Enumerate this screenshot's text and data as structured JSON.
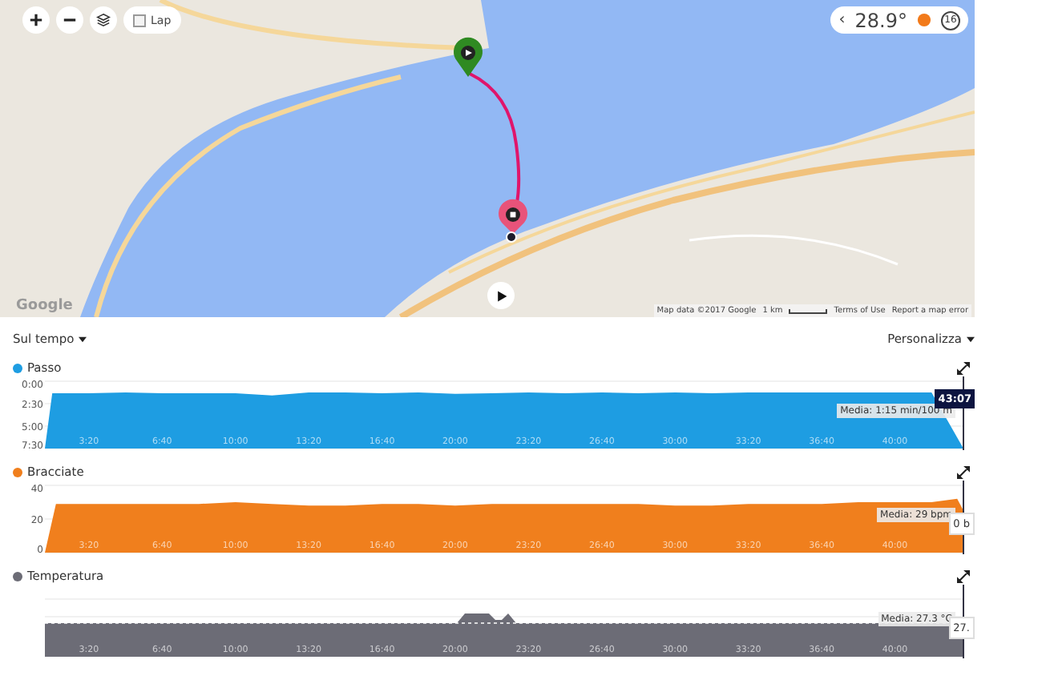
{
  "map": {
    "logo": "Google",
    "lap": {
      "label": "Lap",
      "checked": false
    },
    "weather": {
      "back": "‹",
      "temperature": "28.9°",
      "wind": "16"
    },
    "attribution": [
      "Map data ©2017 Google",
      "1 km",
      "Terms of Use",
      "Report a map error"
    ]
  },
  "toolbar": {
    "view": "Sul tempo",
    "customize": "Personalizza"
  },
  "charts": [
    {
      "color": "#1e9de2",
      "average": "Media: 1:15 min/100 m",
      "readout": {
        "text": "43:07",
        "kind": "time"
      },
      "chart_data": {
        "type": "area",
        "x": [
          80,
          100,
          200,
          300,
          400,
          500,
          600,
          700,
          800,
          900,
          1000,
          1100,
          1200,
          1300,
          1400,
          1500,
          1600,
          1700,
          1800,
          1900,
          2000,
          2100,
          2200,
          2300,
          2400,
          2500,
          2587
        ],
        "series": [
          {
            "name": "Passo",
            "color": "#1e9de2",
            "values": [
              450,
              80,
              80,
              75,
              80,
              80,
              80,
              95,
              75,
              75,
              80,
              75,
              85,
              80,
              75,
              80,
              75,
              80,
              75,
              80,
              75,
              75,
              75,
              75,
              75,
              75,
              450
            ]
          }
        ],
        "xlim": [
          80,
          2587
        ],
        "ylim": [
          450,
          0
        ],
        "yticks": [
          {
            "value": 0,
            "label": "0:00"
          },
          {
            "value": 150,
            "label": "2:30"
          },
          {
            "value": 300,
            "label": "5:00"
          },
          {
            "value": 450,
            "label": "7:30"
          }
        ],
        "xticks": [
          {
            "value": 200,
            "label": "3:20"
          },
          {
            "value": 400,
            "label": "6:40"
          },
          {
            "value": 600,
            "label": "10:00"
          },
          {
            "value": 800,
            "label": "13:20"
          },
          {
            "value": 1000,
            "label": "16:40"
          },
          {
            "value": 1200,
            "label": "20:00"
          },
          {
            "value": 1400,
            "label": "23:20"
          },
          {
            "value": 1600,
            "label": "26:40"
          },
          {
            "value": 1800,
            "label": "30:00"
          },
          {
            "value": 2000,
            "label": "33:20"
          },
          {
            "value": 2200,
            "label": "36:40"
          },
          {
            "value": 2400,
            "label": "40:00"
          }
        ]
      }
    },
    {
      "color": "#f07f1d",
      "average": "Media: 29 bpm",
      "readout": {
        "text": "0 b",
        "kind": "value"
      },
      "chart_data": {
        "type": "area",
        "x": [
          80,
          110,
          200,
          300,
          400,
          500,
          600,
          700,
          800,
          900,
          1000,
          1100,
          1200,
          1300,
          1400,
          1500,
          1600,
          1700,
          1800,
          1900,
          2000,
          2100,
          2200,
          2300,
          2400,
          2500,
          2570,
          2587
        ],
        "series": [
          {
            "name": "Bracciate",
            "color": "#f07f1d",
            "values": [
              0,
              29,
              29,
              29,
              29,
              29,
              30,
              29,
              28,
              28,
              29,
              29,
              28,
              29,
              29,
              29,
              29,
              29,
              28,
              28,
              29,
              29,
              29,
              30,
              30,
              30,
              32,
              25
            ]
          }
        ],
        "xlim": [
          80,
          2587
        ],
        "ylim": [
          0,
          40
        ],
        "yticks": [
          {
            "value": 0,
            "label": "0"
          },
          {
            "value": 20,
            "label": "20"
          },
          {
            "value": 40,
            "label": "40"
          }
        ],
        "xticks": [
          {
            "value": 200,
            "label": "3:20"
          },
          {
            "value": 400,
            "label": "6:40"
          },
          {
            "value": 600,
            "label": "10:00"
          },
          {
            "value": 800,
            "label": "13:20"
          },
          {
            "value": 1000,
            "label": "16:40"
          },
          {
            "value": 1200,
            "label": "20:00"
          },
          {
            "value": 1400,
            "label": "23:20"
          },
          {
            "value": 1600,
            "label": "26:40"
          },
          {
            "value": 1800,
            "label": "30:00"
          },
          {
            "value": 2000,
            "label": "33:20"
          },
          {
            "value": 2200,
            "label": "36:40"
          },
          {
            "value": 2400,
            "label": "40:00"
          }
        ]
      }
    },
    {
      "title": "Temperatura",
      "color": "#6c6c76",
      "average": "Media: 27.3 °C",
      "readout": {
        "text": "27.",
        "kind": "value"
      },
      "x_labels": [
        "3:20",
        "6:40",
        "10:00",
        "13:20",
        "16:40",
        "20:00",
        "23:20",
        "26:40",
        "30:00",
        "33:20",
        "36:40",
        "40:00"
      ]
    }
  ]
}
